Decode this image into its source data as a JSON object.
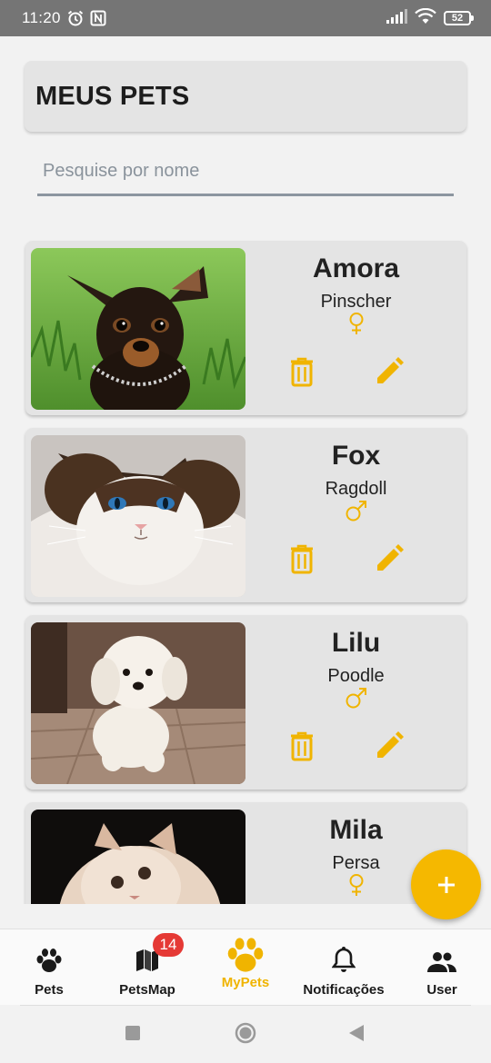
{
  "status_bar": {
    "time": "11:20",
    "battery": "52"
  },
  "header": {
    "title": "MEUS PETS"
  },
  "search": {
    "placeholder": "Pesquise por nome",
    "value": ""
  },
  "pets": [
    {
      "name": "Amora",
      "breed": "Pinscher",
      "sex": "female",
      "sex_symbol": "♀"
    },
    {
      "name": "Fox",
      "breed": "Ragdoll",
      "sex": "male",
      "sex_symbol": "♂"
    },
    {
      "name": "Lilu",
      "breed": "Poodle",
      "sex": "male",
      "sex_symbol": "♂"
    },
    {
      "name": "Mila",
      "breed": "Persa",
      "sex": "female",
      "sex_symbol": "♀"
    }
  ],
  "fab": {
    "icon": "plus-icon"
  },
  "bottom_nav": {
    "items": [
      {
        "label": "Pets",
        "icon": "paw-icon",
        "active": false
      },
      {
        "label": "PetsMap",
        "icon": "map-icon",
        "badge": "14",
        "active": false
      },
      {
        "label": "MyPets",
        "icon": "paw-icon",
        "active": true
      },
      {
        "label": "Notificações",
        "icon": "bell-icon",
        "active": false
      },
      {
        "label": "User",
        "icon": "people-icon",
        "active": false
      }
    ]
  },
  "colors": {
    "accent": "#f5b800",
    "card": "#e4e4e4",
    "badge": "#e53935",
    "status_bar": "#757575"
  }
}
